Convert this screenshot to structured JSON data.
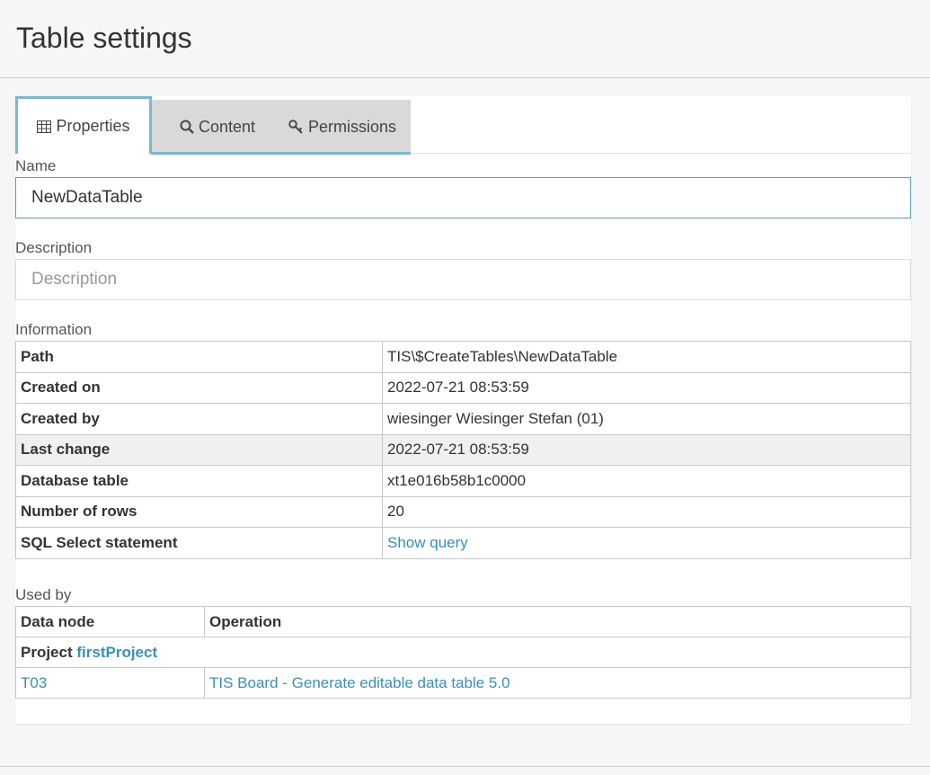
{
  "header": {
    "title": "Table settings"
  },
  "tabs": [
    {
      "label": "Properties",
      "icon": "table-icon",
      "active": true
    },
    {
      "label": "Content",
      "icon": "search-icon",
      "active": false
    },
    {
      "label": "Permissions",
      "icon": "key-icon",
      "active": false
    }
  ],
  "form": {
    "name_label": "Name",
    "name_value": "NewDataTable",
    "description_label": "Description",
    "description_placeholder": "Description"
  },
  "information": {
    "label": "Information",
    "rows": [
      {
        "key": "Path",
        "value": "TIS\\$CreateTables\\NewDataTable"
      },
      {
        "key": "Created on",
        "value": "2022-07-21 08:53:59"
      },
      {
        "key": "Created by",
        "value": "wiesinger Wiesinger Stefan (01)"
      },
      {
        "key": "Last change",
        "value": "2022-07-21 08:53:59"
      },
      {
        "key": "Database table",
        "value": "xt1e016b58b1c0000"
      },
      {
        "key": "Number of rows",
        "value": "20"
      },
      {
        "key": "SQL Select statement",
        "value": "Show query"
      }
    ]
  },
  "used_by": {
    "label": "Used by",
    "headers": [
      "Data node",
      "Operation"
    ],
    "project_prefix": "Project",
    "project_name": "firstProject",
    "rows": [
      {
        "node": "T03",
        "operation": "TIS Board - Generate editable data table 5.0"
      }
    ]
  },
  "colors": {
    "accent": "#7fb6cc",
    "link": "#3a8fb7",
    "tab_inactive_bg": "#d9d9d9"
  }
}
